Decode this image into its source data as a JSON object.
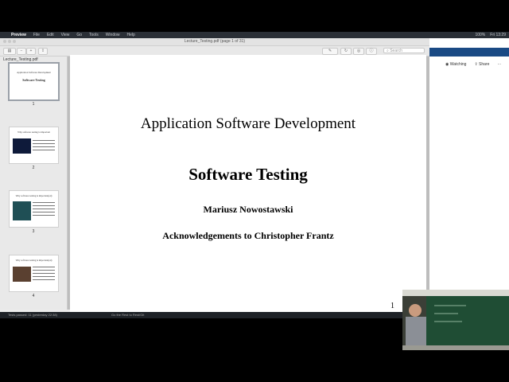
{
  "menubar": {
    "app": "Preview",
    "menus": [
      "Preview",
      "File",
      "Edit",
      "View",
      "Go",
      "Tools",
      "Window",
      "Help"
    ],
    "right": [
      "100%",
      "Fri 13:29"
    ]
  },
  "window": {
    "title": "Lecture_Testing.pdf (page 1 of 31)",
    "search_placeholder": "Search"
  },
  "sidebar": {
    "filename": "Lecture_Testing.pdf",
    "thumbnails": [
      {
        "page": "1",
        "title": "Application Software Development",
        "subtitle": "Software Testing"
      },
      {
        "page": "2",
        "title": "Why software testing is important"
      },
      {
        "page": "3",
        "title": "Why software testing is important(ed)"
      },
      {
        "page": "4",
        "title": "Why software testing is important(ed)"
      }
    ]
  },
  "page": {
    "title": "Application Software Development",
    "subtitle": "Software Testing",
    "author": "Mariusz Nowostawski",
    "acknowledgement": "Acknowledgements to Christopher Frantz",
    "page_number": "1"
  },
  "status": {
    "left": "Tests passed: 11 (yesterday 22:38)",
    "mid": "Go the Rest to Rest/Git"
  },
  "right_panel": {
    "watching": "Watching",
    "share": "Share",
    "more": "···"
  },
  "icons": [
    "apple-icon",
    "sidebar-icon",
    "zoom-out-icon",
    "zoom-in-icon",
    "share-icon",
    "markup-icon",
    "rotate-icon",
    "search-icon",
    "eye-icon"
  ]
}
